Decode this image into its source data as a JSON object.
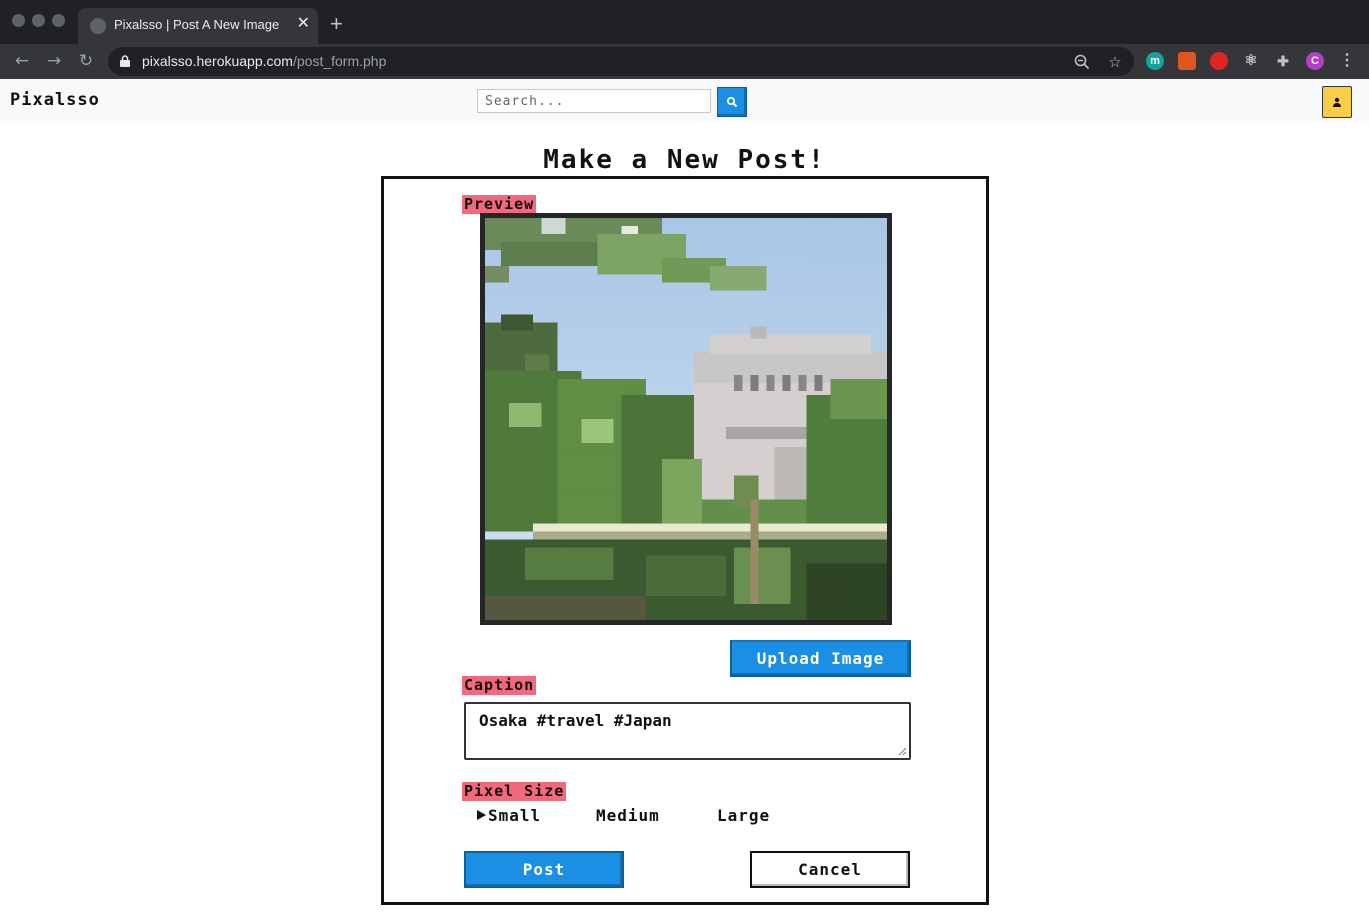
{
  "browser": {
    "tab_title": "Pixalsso | Post A New Image",
    "tab_close": "✕",
    "new_tab": "+",
    "url_host": "pixalsso.herokuapp.com",
    "url_path": "/post_form.php",
    "extensions": [
      {
        "label": "m",
        "color": "#12a59c"
      },
      {
        "label": "",
        "color": "#e0561e"
      },
      {
        "label": "",
        "color": "#e02424"
      },
      {
        "label": "",
        "color": "#bdc1c6"
      },
      {
        "label": "",
        "color": "#bdc1c6"
      },
      {
        "label": "C",
        "color": "#b23fc4"
      }
    ]
  },
  "header": {
    "brand": "Pixalsso",
    "search_placeholder": "Search...",
    "accent": "#1a8fe3",
    "avatar_color": "#f7ce46"
  },
  "form": {
    "title": "Make a New Post!",
    "preview_label": "Preview",
    "upload_label": "Upload Image",
    "caption_label": "Caption",
    "caption_value": "Osaka #travel #Japan",
    "pixel_size_label": "Pixel Size",
    "pixel_sizes": [
      "Small",
      "Medium",
      "Large"
    ],
    "selected_pixel_size": "Small",
    "post_label": "Post",
    "cancel_label": "Cancel",
    "label_color": "#f2687c"
  }
}
